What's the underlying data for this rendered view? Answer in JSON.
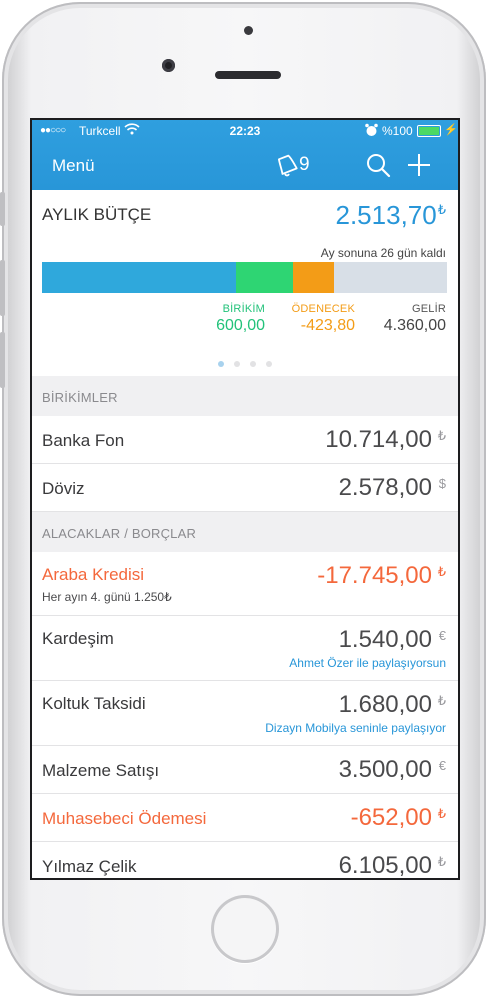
{
  "status_bar": {
    "signal_dots": "●●○○○",
    "carrier": "Turkcell",
    "time": "22:23",
    "battery_percent": "%100"
  },
  "nav": {
    "menu_label": "Menü",
    "notification_count": "9"
  },
  "budget": {
    "title": "AYLIK BÜTÇE",
    "amount": "2.513,70",
    "currency": "₺",
    "remaining_text": "Ay sonuna 26 gün kaldı",
    "bar_segments": [
      {
        "name": "birikim",
        "fraction": 0.48,
        "color": "#2fa8dc"
      },
      {
        "name": "odenen",
        "fraction": 0.14,
        "color": "#2ed573"
      },
      {
        "name": "odenecek",
        "fraction": 0.1,
        "color": "#f39c17"
      },
      {
        "name": "kalan",
        "fraction": 0.28,
        "color": "#d8dfe7"
      }
    ],
    "legend": {
      "birikim": {
        "label": "BİRİKİM",
        "value": "600,00",
        "color": "#22c27a"
      },
      "odenecek": {
        "label": "ÖDENECEK",
        "value": "-423,80",
        "color": "#f39c17"
      },
      "gelir": {
        "label": "GELİR",
        "value": "4.360,00",
        "color": "#555555"
      }
    },
    "page_count": 4,
    "active_page": 1
  },
  "savings": {
    "header": "BİRİKİMLER",
    "items": [
      {
        "name": "Banka Fon",
        "value": "10.714,00",
        "currency": "₺"
      },
      {
        "name": "Döviz",
        "value": "2.578,00",
        "currency": "$"
      }
    ]
  },
  "debts": {
    "header": "ALACAKLAR / BORÇLAR",
    "items": [
      {
        "name": "Araba Kredisi",
        "sub": "Her ayın 4. günü 1.250₺",
        "value": "-17.745,00",
        "currency": "₺",
        "negative": true
      },
      {
        "name": "Kardeşim",
        "share": "Ahmet Özer ile paylaşıyorsun",
        "value": "1.540,00",
        "currency": "€"
      },
      {
        "name": "Koltuk Taksidi",
        "share": "Dizayn Mobilya seninle paylaşıyor",
        "value": "1.680,00",
        "currency": "₺"
      },
      {
        "name": "Malzeme Satışı",
        "value": "3.500,00",
        "currency": "€"
      },
      {
        "name": "Muhasebeci Ödemesi",
        "value": "-652,00",
        "currency": "₺",
        "negative": true
      },
      {
        "name": "Yılmaz Çelik",
        "value": "6.105,00",
        "currency": "₺"
      }
    ]
  }
}
